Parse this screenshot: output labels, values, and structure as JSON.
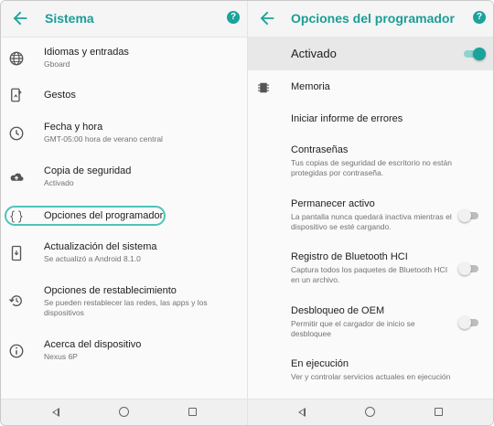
{
  "left": {
    "title": "Sistema",
    "items": [
      {
        "label": "Idiomas y entradas",
        "sub": "Gboard"
      },
      {
        "label": "Gestos"
      },
      {
        "label": "Fecha y hora",
        "sub": "GMT-05:00 hora de verano central"
      },
      {
        "label": "Copia de seguridad",
        "sub": "Activado"
      },
      {
        "label": "Opciones del programador"
      },
      {
        "label": "Actualización del sistema",
        "sub": "Se actualizó a Android 8.1.0"
      },
      {
        "label": "Opciones de restablecimiento",
        "sub": "Se pueden restablecer las redes, las apps y los dispositivos"
      },
      {
        "label": "Acerca del dispositivo",
        "sub": "Nexus 6P"
      }
    ]
  },
  "right": {
    "title": "Opciones del programador",
    "master_toggle": {
      "label": "Activado",
      "on": true
    },
    "items": [
      {
        "label": "Memoria"
      },
      {
        "label": "Iniciar informe de errores"
      },
      {
        "label": "Contraseñas",
        "sub": "Tus copias de seguridad de escritorio no están protegidas por contraseña."
      },
      {
        "label": "Permanecer activo",
        "sub": "La pantalla nunca quedará inactiva mientras el dispositivo se esté cargando.",
        "toggle": false
      },
      {
        "label": "Registro de Bluetooth HCI",
        "sub": "Captura todos los paquetes de Bluetooth HCI en un archivo.",
        "toggle": false
      },
      {
        "label": "Desbloqueo de OEM",
        "sub": "Permitir que el cargador de inicio se desbloquee",
        "toggle": false
      },
      {
        "label": "En ejecución",
        "sub": "Ver y controlar servicios actuales en ejecución"
      }
    ]
  },
  "help_glyph": "?",
  "colors": {
    "accent": "#1aa39a",
    "highlight": "#4fc3b8"
  }
}
